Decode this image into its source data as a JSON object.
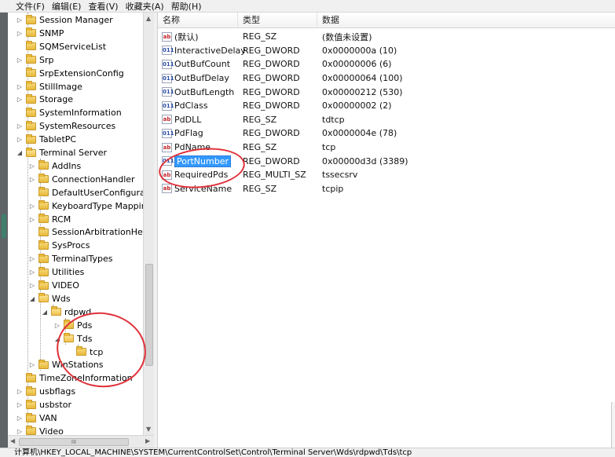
{
  "menu": [
    "文件(F)",
    "编辑(E)",
    "查看(V)",
    "收藏夹(A)",
    "帮助(H)"
  ],
  "tree": {
    "items": [
      {
        "label": "Session Manager",
        "arrow": "▷"
      },
      {
        "label": "SNMP",
        "arrow": "▷"
      },
      {
        "label": "SQMServiceList",
        "arrow": ""
      },
      {
        "label": "Srp",
        "arrow": "▷"
      },
      {
        "label": "SrpExtensionConfig",
        "arrow": ""
      },
      {
        "label": "StillImage",
        "arrow": "▷"
      },
      {
        "label": "Storage",
        "arrow": "▷"
      },
      {
        "label": "SystemInformation",
        "arrow": ""
      },
      {
        "label": "SystemResources",
        "arrow": "▷"
      },
      {
        "label": "TabletPC",
        "arrow": "▷"
      },
      {
        "label": "Terminal Server",
        "arrow": "◢"
      },
      {
        "label": "AddIns",
        "arrow": "▷"
      },
      {
        "label": "ConnectionHandler",
        "arrow": "▷"
      },
      {
        "label": "DefaultUserConfigurat",
        "arrow": ""
      },
      {
        "label": "KeyboardType Mappir",
        "arrow": "▷"
      },
      {
        "label": "RCM",
        "arrow": "▷"
      },
      {
        "label": "SessionArbitrationHelp",
        "arrow": ""
      },
      {
        "label": "SysProcs",
        "arrow": ""
      },
      {
        "label": "TerminalTypes",
        "arrow": "▷"
      },
      {
        "label": "Utilities",
        "arrow": "▷"
      },
      {
        "label": "VIDEO",
        "arrow": "▷"
      },
      {
        "label": "Wds",
        "arrow": "◢"
      },
      {
        "label": "rdpwd",
        "arrow": "◢"
      },
      {
        "label": "Pds",
        "arrow": "▷"
      },
      {
        "label": "Tds",
        "arrow": "◢"
      },
      {
        "label": "tcp",
        "arrow": ""
      },
      {
        "label": "WinStations",
        "arrow": "▷"
      },
      {
        "label": "TimeZoneInformation",
        "arrow": ""
      },
      {
        "label": "usbflags",
        "arrow": "▷"
      },
      {
        "label": "usbstor",
        "arrow": "▷"
      },
      {
        "label": "VAN",
        "arrow": "▷"
      },
      {
        "label": "Video",
        "arrow": "▷"
      }
    ],
    "hscroll_grip": "III"
  },
  "columns": {
    "name": "名称",
    "type": "类型",
    "data": "数据"
  },
  "values": [
    {
      "name": "(默认)",
      "type": "REG_SZ",
      "data": "(数值未设置)",
      "icon": "ab"
    },
    {
      "name": "InteractiveDelay",
      "type": "REG_DWORD",
      "data": "0x0000000a (10)",
      "icon": "011"
    },
    {
      "name": "OutBufCount",
      "type": "REG_DWORD",
      "data": "0x00000006 (6)",
      "icon": "011"
    },
    {
      "name": "OutBufDelay",
      "type": "REG_DWORD",
      "data": "0x00000064 (100)",
      "icon": "011"
    },
    {
      "name": "OutBufLength",
      "type": "REG_DWORD",
      "data": "0x00000212 (530)",
      "icon": "011"
    },
    {
      "name": "PdClass",
      "type": "REG_DWORD",
      "data": "0x00000002 (2)",
      "icon": "011"
    },
    {
      "name": "PdDLL",
      "type": "REG_SZ",
      "data": "tdtcp",
      "icon": "ab"
    },
    {
      "name": "PdFlag",
      "type": "REG_DWORD",
      "data": "0x0000004e (78)",
      "icon": "011"
    },
    {
      "name": "PdName",
      "type": "REG_SZ",
      "data": "tcp",
      "icon": "ab"
    },
    {
      "name": "PortNumber",
      "type": "REG_DWORD",
      "data": "0x00000d3d (3389)",
      "icon": "011",
      "selected": true
    },
    {
      "name": "RequiredPds",
      "type": "REG_MULTI_SZ",
      "data": "tssecsrv",
      "icon": "ab"
    },
    {
      "name": "ServiceName",
      "type": "REG_SZ",
      "data": "tcpip",
      "icon": "ab"
    }
  ],
  "status": "计算机\\HKEY_LOCAL_MACHINE\\SYSTEM\\CurrentControlSet\\Control\\Terminal Server\\Wds\\rdpwd\\Tds\\tcp",
  "colors": {
    "selection": "#3399ff",
    "annotation": "#e0303a",
    "folder": "#e8b93a"
  }
}
